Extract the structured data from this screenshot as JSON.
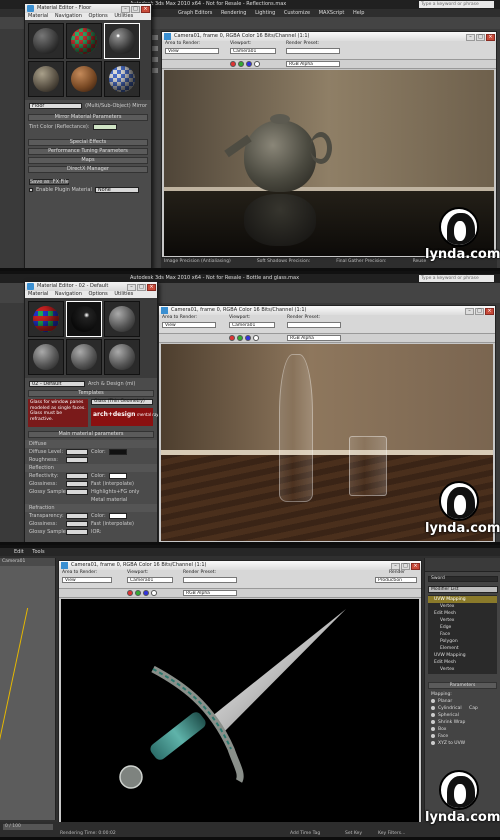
{
  "app": {
    "search_placeholder": "Type a keyword or phrase",
    "menu": [
      "Graph Editors",
      "Rendering",
      "Lighting",
      "Customize",
      "MAXScript",
      "Help"
    ]
  },
  "panel1": {
    "app_title": "Autodesk 3ds Max 2010 x64 - Not for Resale - Reflections.max",
    "mat_title": "Material Editor - Floor",
    "mat_menu": [
      "Material",
      "Navigation",
      "Options",
      "Utilities"
    ],
    "mat_name": "Floor",
    "mat_type": "(Multi/Sub-Object) Mirror",
    "mirror_params": "Mirror Material Parameters",
    "tint_label": "Tint Color (Reflectance):",
    "rollouts": [
      "Special Effects",
      "Performance Tuning Parameters",
      "Maps",
      "DirectX Manager"
    ],
    "save_fx": "Save as .FX File",
    "enable_plugin": "Enable Plugin Material",
    "plugin_value": "None",
    "vp_title": "Camera01, frame 0, RGBA Color 16 Bits/Channel (1:1)",
    "area_label": "Area to Render:",
    "area_value": "View",
    "viewport_label": "Viewport:",
    "viewport_value": "Camera01",
    "preset_label": "Render Preset:",
    "channel_value": "RGB Alpha",
    "status_items": [
      "Image Precision (Antialiasing)",
      "Soft Shadows Precision:",
      "Final Gather Precision:",
      "Reuse"
    ],
    "logo": "lynda.com"
  },
  "panel2": {
    "app_title": "Autodesk 3ds Max 2010 x64 - Not for Resale - Bottle and glass.max",
    "mat_title": "Material Editor - 02 - Default",
    "mat_menu": [
      "Material",
      "Navigation",
      "Options",
      "Utilities"
    ],
    "mat_name": "02 - Default",
    "mat_type": "Arch & Design (mi)",
    "templates": "Templates",
    "template_desc": "Glass for window panes modeled as single faces. Glass must be refractive.",
    "template_value": "Glass (Thin Geometry)",
    "ad_logo": "arch+design",
    "ad_sub": "mental ray",
    "main_params": "Main material parameters",
    "diffuse": "Diffuse",
    "diffuse_level": "Diffuse Level:",
    "roughness": "Roughness:",
    "color": "Color:",
    "reflection": "Reflection",
    "reflectivity": "Reflectivity:",
    "glossiness": "Glossiness:",
    "glossy_samples": "Glossy Samples:",
    "fast_interp": "Fast (interpolate)",
    "highlights_fg": "Highlights+FG only",
    "metal_material": "Metal material",
    "refraction": "Refraction",
    "transparency": "Transparency:",
    "ior": "IOR:",
    "vp_title": "Camera01, frame 0, RGBA Color 16 Bits/Channel (1:1)",
    "area_label": "Area to Render:",
    "area_value": "View",
    "viewport_label": "Viewport:",
    "viewport_value": "Camera01",
    "preset_label": "Render Preset:",
    "channel_value": "RGB Alpha",
    "logo": "lynda.com"
  },
  "panel3": {
    "menu": [
      "Edit",
      "Tools"
    ],
    "vp_title": "Camera01, frame 0, RGBA Color 16 Bits/Channel (1:1)",
    "area_label": "Area to Render:",
    "area_value": "View",
    "viewport_label": "Viewport:",
    "viewport_value": "Camera01",
    "preset_label": "Render Preset:",
    "render_label": "Render",
    "render_value": "Production",
    "channel_value": "RGB Alpha",
    "object_name": "Sword",
    "modifier_list": "Modifier List",
    "stack": [
      "UVW Mapping",
      "Vertex",
      "Edit Mesh",
      "Vertex",
      "Edge",
      "Face",
      "Polygon",
      "Element",
      "UVW Mapping",
      "Edit Mesh",
      "Vertex"
    ],
    "parameters": "Parameters",
    "mapping": "Mapping:",
    "mapping_options": [
      "Planar",
      "Cylindrical",
      "Spherical",
      "Shrink Wrap",
      "Box",
      "Face",
      "XYZ to UVW"
    ],
    "cap": "Cap",
    "frame_readout": "0 / 100",
    "status_left": "Rendering Time: 0:00:02",
    "status_right": [
      "Add Time Tag",
      "Set Key",
      "Key Filters..."
    ],
    "logo": "lynda.com"
  }
}
